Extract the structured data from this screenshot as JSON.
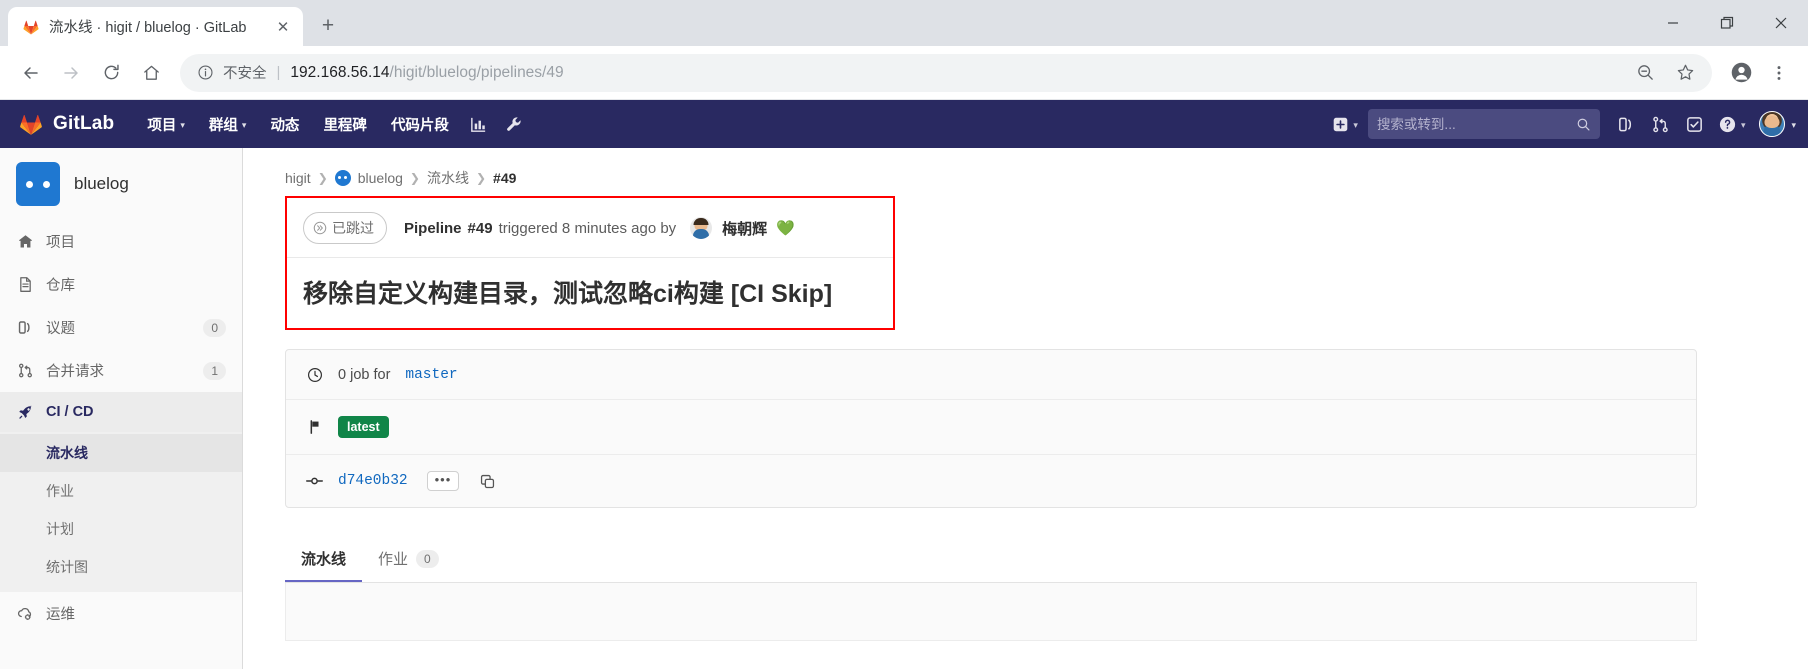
{
  "browser": {
    "tab": {
      "title": "流水线 · higit / bluelog · GitLab",
      "favicon": "gitlab-favicon",
      "close_label": "✕"
    },
    "new_tab_label": "+",
    "window_controls": {
      "minimize": "minimize-icon",
      "maximize": "maximize-icon",
      "close": "close-icon"
    },
    "nav": {
      "back": "back-icon",
      "forward": "forward-icon",
      "reload": "reload-icon",
      "home": "home-icon"
    },
    "omnibox": {
      "info_icon": "info-circle-icon",
      "not_secure": "不安全",
      "separator": "|",
      "host": "192.168.56.14",
      "path": "/higit/bluelog/pipelines/49",
      "zoom_icon": "zoom-out-icon",
      "bookmark_icon": "star-icon"
    },
    "profile_icon": "account-icon",
    "menu_icon": "kebab-menu-icon"
  },
  "navbar": {
    "brand": "GitLab",
    "logo": "gitlab-logo",
    "items": [
      {
        "label": "项目",
        "caret": "▾"
      },
      {
        "label": "群组",
        "caret": "▾"
      },
      {
        "label": "动态",
        "caret": ""
      },
      {
        "label": "里程碑",
        "caret": ""
      },
      {
        "label": "代码片段",
        "caret": ""
      }
    ],
    "icons": [
      {
        "name": "analytics-icon"
      },
      {
        "name": "wrench-icon"
      }
    ],
    "create_new": {
      "icon": "plus-square-icon",
      "caret": "▾"
    },
    "search": {
      "placeholder": "搜索或转到...",
      "value": "",
      "icon": "search-icon"
    },
    "right_icons": [
      {
        "name": "issues-icon"
      },
      {
        "name": "merge-requests-icon"
      },
      {
        "name": "todos-icon"
      }
    ],
    "help": {
      "icon": "help-circle-icon",
      "caret": "▾"
    },
    "user": {
      "avatar": "user-avatar",
      "caret": "▾"
    }
  },
  "sidebar": {
    "project": {
      "name": "bluelog",
      "avatar": "project-avatar"
    },
    "items": [
      {
        "label": "项目",
        "icon": "home-icon",
        "badge": "",
        "active": false
      },
      {
        "label": "仓库",
        "icon": "document-icon",
        "badge": "",
        "active": false
      },
      {
        "label": "议题",
        "icon": "issues-icon",
        "badge": "0",
        "active": false
      },
      {
        "label": "合并请求",
        "icon": "merge-request-icon",
        "badge": "1",
        "active": false
      },
      {
        "label": "CI / CD",
        "icon": "rocket-icon",
        "badge": "",
        "active": true
      }
    ],
    "subitems": [
      {
        "label": "流水线",
        "active": true
      },
      {
        "label": "作业",
        "active": false
      },
      {
        "label": "计划",
        "active": false
      },
      {
        "label": "统计图",
        "active": false
      }
    ],
    "footer_items": [
      {
        "label": "运维",
        "icon": "operations-icon"
      }
    ]
  },
  "breadcrumb": [
    {
      "label": "higit",
      "type": "link"
    },
    {
      "label": "bluelog",
      "type": "link-with-avatar"
    },
    {
      "label": "流水线",
      "type": "link"
    },
    {
      "label": "#49",
      "type": "current"
    }
  ],
  "pipeline": {
    "status": {
      "label": "已跳过",
      "icon": "skipped-icon"
    },
    "prefix": "Pipeline",
    "number": "#49",
    "triggered_text": "triggered 8 minutes ago by",
    "author": "梅朝辉",
    "author_emoji": "💚",
    "title": "移除自定义构建目录，测试忽略ci构建 [CI Skip]",
    "job_summary": {
      "icon": "clock-icon",
      "text": "0 job for",
      "ref": "master"
    },
    "tag": {
      "icon": "flag-icon",
      "label": "latest"
    },
    "commit": {
      "icon": "commit-icon",
      "sha": "d74e0b32",
      "more_label": "•••",
      "copy_icon": "copy-icon"
    }
  },
  "tabs": [
    {
      "label": "流水线",
      "count": "",
      "active": true
    },
    {
      "label": "作业",
      "count": "0",
      "active": false
    }
  ],
  "colors": {
    "navbar_bg": "#292961",
    "accent": "#1068bf",
    "success": "#108548",
    "highlight_box": "#ff0000"
  }
}
